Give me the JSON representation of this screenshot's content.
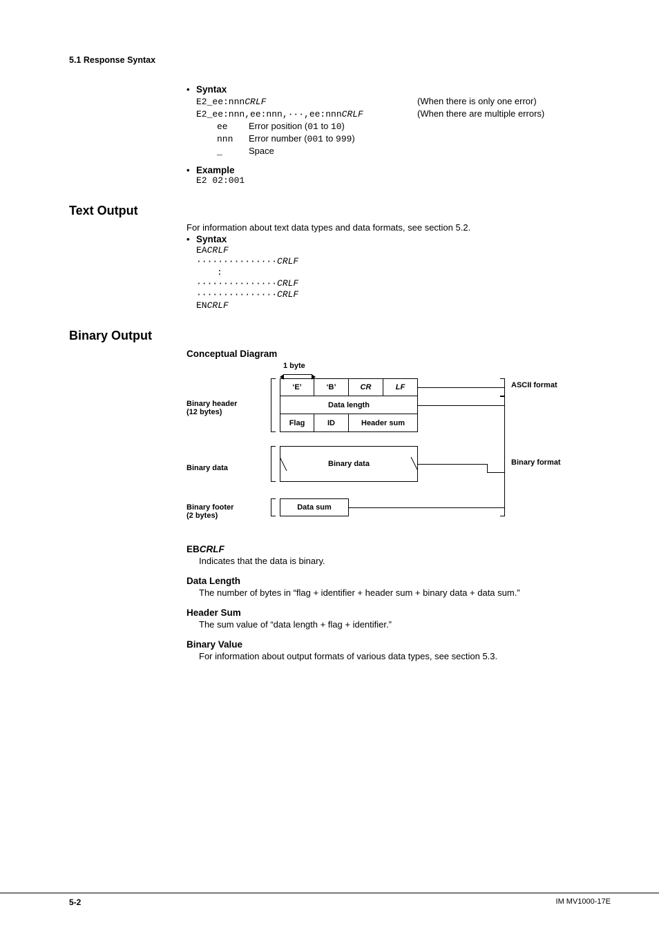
{
  "running_head": "5.1  Response Syntax",
  "sec1": {
    "syntax_label": "Syntax",
    "line1_code": "E2_ee:nnn",
    "line1_crlf": "CRLF",
    "line1_note": "(When there is only one error)",
    "line2_code": "E2_ee:nnn,ee:nnn,···,ee:nnn",
    "line2_crlf": "CRLF",
    "line2_note": "(When there are multiple errors)",
    "def_ee_term": "ee",
    "def_ee_a": "Error position (",
    "def_ee_b": "01",
    "def_ee_c": " to ",
    "def_ee_d": "10",
    "def_ee_e": ")",
    "def_nnn_term": "nnn",
    "def_nnn_a": "Error number (",
    "def_nnn_b": "001",
    "def_nnn_c": " to ",
    "def_nnn_d": "999",
    "def_nnn_e": ")",
    "def_sp_term": "_",
    "def_sp_desc": "Space",
    "example_label": "Example",
    "example_code": "E2 02:001"
  },
  "text_output": {
    "title": "Text Output",
    "intro": "For information about text data types and data formats, see section 5.2.",
    "syntax_label": "Syntax",
    "l1a": "EA",
    "l1b": "CRLF",
    "dots": "···············",
    "crlf": "CRLF",
    "colon": ":",
    "lNa": "EN",
    "lNb": "CRLF"
  },
  "binary_output": {
    "title": "Binary Output",
    "diagram_title": "Conceptual Diagram",
    "byte_label": "1 byte",
    "header_label_1": "Binary header",
    "header_label_2": "(12 bytes)",
    "data_label": "Binary data",
    "footer_label_1": "Binary footer",
    "footer_label_2": "(2 bytes)",
    "cell_E": "‘E’",
    "cell_B": "‘B’",
    "cell_CR": "CR",
    "cell_LF": "LF",
    "cell_datalen": "Data length",
    "cell_flag": "Flag",
    "cell_id": "ID",
    "cell_hsum": "Header sum",
    "cell_bindata": "Binary data",
    "cell_dsum": "Data sum",
    "lab_ascii": "ASCII format",
    "lab_binfmt": "Binary format",
    "eb_head_a": "EB",
    "eb_head_b": "CRLF",
    "eb_body": "Indicates that the data is binary.",
    "dl_head": "Data Length",
    "dl_body": "The number of bytes in “flag + identifier + header sum + binary data + data sum.”",
    "hs_head": "Header Sum",
    "hs_body": "The sum value of “data length + flag + identifier.”",
    "bv_head": "Binary Value",
    "bv_body": "For information about output formats of various data types, see section 5.3."
  },
  "footer": {
    "page": "5-2",
    "doc": "IM MV1000-17E"
  }
}
